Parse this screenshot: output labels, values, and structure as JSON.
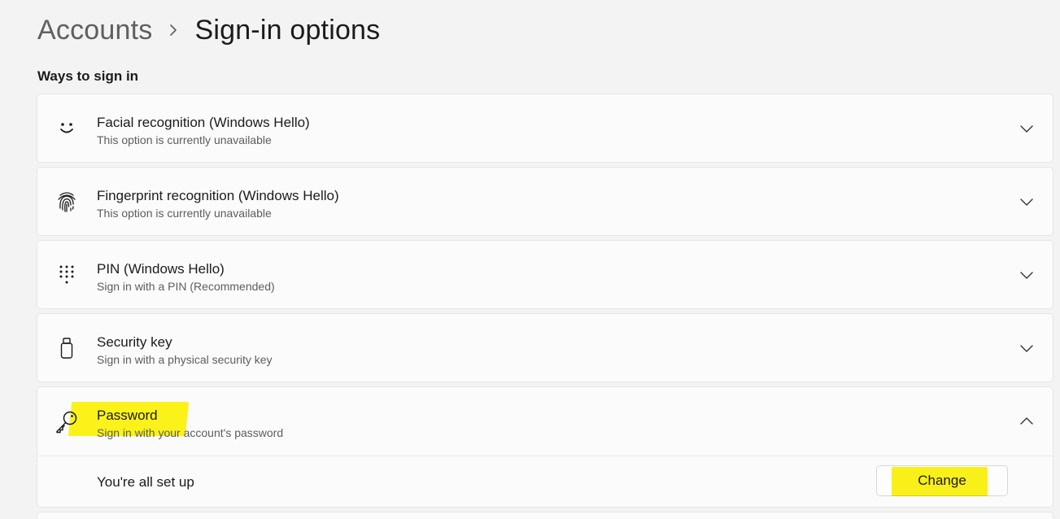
{
  "breadcrumb": {
    "parent": "Accounts",
    "current": "Sign-in options"
  },
  "section": {
    "title": "Ways to sign in"
  },
  "items": [
    {
      "icon": "face-smile-icon",
      "title": "Facial recognition (Windows Hello)",
      "subtitle": "This option is currently unavailable",
      "expanded": false
    },
    {
      "icon": "fingerprint-icon",
      "title": "Fingerprint recognition (Windows Hello)",
      "subtitle": "This option is currently unavailable",
      "expanded": false
    },
    {
      "icon": "keypad-icon",
      "title": "PIN (Windows Hello)",
      "subtitle": "Sign in with a PIN (Recommended)",
      "expanded": false
    },
    {
      "icon": "usb-key-icon",
      "title": "Security key",
      "subtitle": "Sign in with a physical security key",
      "expanded": false
    },
    {
      "icon": "key-icon",
      "title": "Password",
      "subtitle": "Sign in with your account's password",
      "expanded": true
    }
  ],
  "password_detail": {
    "status": "You're all set up",
    "button_label": "Change"
  },
  "colors": {
    "highlight": "#fbf21a",
    "background": "#f3f3f3",
    "card": "#fbfbfb"
  }
}
